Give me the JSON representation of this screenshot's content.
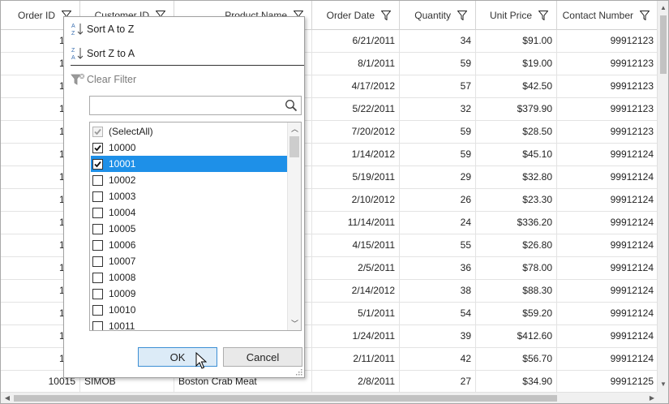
{
  "columns": [
    {
      "label": "Order ID"
    },
    {
      "label": "Customer ID"
    },
    {
      "label": "Product Name"
    },
    {
      "label": "Order Date"
    },
    {
      "label": "Quantity"
    },
    {
      "label": "Unit Price"
    },
    {
      "label": "Contact Number"
    }
  ],
  "rows": [
    {
      "order_id": "100",
      "customer_id": "",
      "product": "",
      "date": "6/21/2011",
      "qty": "34",
      "price": "$91.00",
      "contact": "99912123"
    },
    {
      "order_id": "100",
      "customer_id": "",
      "product": "",
      "date": "8/1/2011",
      "qty": "59",
      "price": "$19.00",
      "contact": "99912123"
    },
    {
      "order_id": "100",
      "customer_id": "",
      "product": "",
      "date": "4/17/2012",
      "qty": "57",
      "price": "$42.50",
      "contact": "99912123"
    },
    {
      "order_id": "100",
      "customer_id": "",
      "product": "",
      "date": "5/22/2011",
      "qty": "32",
      "price": "$379.90",
      "contact": "99912123"
    },
    {
      "order_id": "100",
      "customer_id": "",
      "product": "",
      "date": "7/20/2012",
      "qty": "59",
      "price": "$28.50",
      "contact": "99912123"
    },
    {
      "order_id": "100",
      "customer_id": "",
      "product": "",
      "date": "1/14/2012",
      "qty": "59",
      "price": "$45.10",
      "contact": "99912124"
    },
    {
      "order_id": "100",
      "customer_id": "",
      "product": "",
      "date": "5/19/2011",
      "qty": "29",
      "price": "$32.80",
      "contact": "99912124"
    },
    {
      "order_id": "100",
      "customer_id": "",
      "product": "",
      "date": "2/10/2012",
      "qty": "26",
      "price": "$23.30",
      "contact": "99912124"
    },
    {
      "order_id": "100",
      "customer_id": "",
      "product": "",
      "date": "11/14/2011",
      "qty": "24",
      "price": "$336.20",
      "contact": "99912124"
    },
    {
      "order_id": "100",
      "customer_id": "",
      "product": "",
      "date": "4/15/2011",
      "qty": "55",
      "price": "$26.80",
      "contact": "99912124"
    },
    {
      "order_id": "100",
      "customer_id": "",
      "product": "",
      "date": "2/5/2011",
      "qty": "36",
      "price": "$78.00",
      "contact": "99912124"
    },
    {
      "order_id": "100",
      "customer_id": "",
      "product": "",
      "date": "2/14/2012",
      "qty": "38",
      "price": "$88.30",
      "contact": "99912124"
    },
    {
      "order_id": "100",
      "customer_id": "",
      "product": "",
      "date": "5/1/2011",
      "qty": "54",
      "price": "$59.20",
      "contact": "99912124"
    },
    {
      "order_id": "100",
      "customer_id": "",
      "product": "",
      "date": "1/24/2011",
      "qty": "39",
      "price": "$412.60",
      "contact": "99912124"
    },
    {
      "order_id": "100",
      "customer_id": "",
      "product": "",
      "date": "2/11/2011",
      "qty": "42",
      "price": "$56.70",
      "contact": "99912124"
    },
    {
      "order_id": "10015",
      "customer_id": "SIMOB",
      "product": "Boston Crab Meat",
      "date": "2/8/2011",
      "qty": "27",
      "price": "$34.90",
      "contact": "99912125"
    }
  ],
  "filter_popup": {
    "sort_asc": "Sort A to Z",
    "sort_desc": "Sort Z to A",
    "clear_filter": "Clear Filter",
    "search_placeholder": "",
    "items": [
      {
        "label": "(SelectAll)",
        "checked": true,
        "disabled": true
      },
      {
        "label": "10000",
        "checked": true
      },
      {
        "label": "10001",
        "checked": true,
        "selected": true
      },
      {
        "label": "10002",
        "checked": false
      },
      {
        "label": "10003",
        "checked": false
      },
      {
        "label": "10004",
        "checked": false
      },
      {
        "label": "10005",
        "checked": false
      },
      {
        "label": "10006",
        "checked": false
      },
      {
        "label": "10007",
        "checked": false
      },
      {
        "label": "10008",
        "checked": false
      },
      {
        "label": "10009",
        "checked": false
      },
      {
        "label": "10010",
        "checked": false
      },
      {
        "label": "10011",
        "checked": false
      }
    ],
    "ok_label": "OK",
    "cancel_label": "Cancel"
  },
  "colors": {
    "selection": "#1e90e8",
    "ok_button_border": "#3c8fd4"
  }
}
